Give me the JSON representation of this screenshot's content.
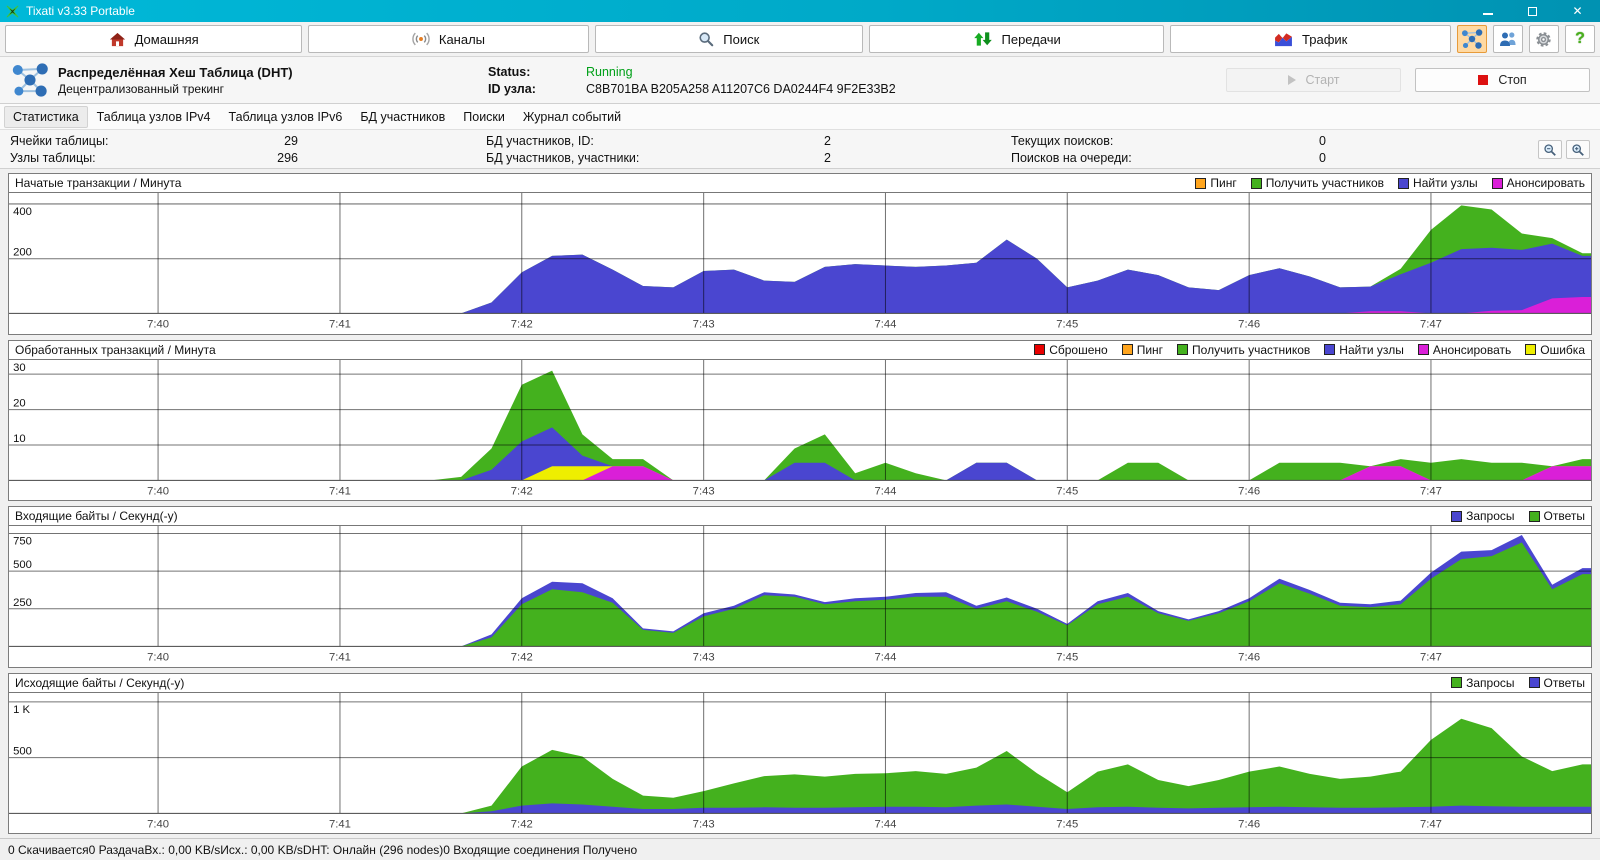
{
  "titlebar": {
    "title": "Tixati v3.33 Portable"
  },
  "toolbar": {
    "buttons": [
      {
        "label": "Домашняя",
        "icon": "home-icon"
      },
      {
        "label": "Каналы",
        "icon": "channels-icon"
      },
      {
        "label": "Поиск",
        "icon": "search-icon"
      },
      {
        "label": "Передачи",
        "icon": "transfers-icon"
      },
      {
        "label": "Трафик",
        "icon": "traffic-icon"
      }
    ],
    "right_buttons": [
      {
        "name": "dht",
        "icon": "dht-molecule-icon",
        "active": true
      },
      {
        "name": "peers",
        "icon": "people-icon",
        "active": false
      },
      {
        "name": "settings",
        "icon": "gear-icon",
        "active": false
      },
      {
        "name": "help",
        "icon": "question-icon",
        "active": false
      }
    ]
  },
  "dht": {
    "title": "Распределённая Хеш Таблица (DHT)",
    "subtitle": "Децентрализованный трекинг",
    "status_label": "Status:",
    "status_value": "Running",
    "status_color": "#00a018",
    "id_label": "ID узла:",
    "id_value": "C8B701BA B205A258 A11207C6 DA0244F4 9F2E33B2",
    "start_label": "Старт",
    "stop_label": "Стоп"
  },
  "tabs": [
    {
      "label": "Статистика",
      "active": true
    },
    {
      "label": "Таблица узлов IPv4",
      "active": false
    },
    {
      "label": "Таблица узлов IPv6",
      "active": false
    },
    {
      "label": "БД участников",
      "active": false
    },
    {
      "label": "Поиски",
      "active": false
    },
    {
      "label": "Журнал событий",
      "active": false
    }
  ],
  "stats": {
    "columns": [
      [
        {
          "label": "Ячейки таблицы:",
          "value": "29"
        },
        {
          "label": "Узлы таблицы:",
          "value": "296"
        }
      ],
      [
        {
          "label": "БД участников, ID:",
          "value": "2"
        },
        {
          "label": "БД участников, участники:",
          "value": "2"
        }
      ],
      [
        {
          "label": "Текущих поисков:",
          "value": "0"
        },
        {
          "label": "Поисков на очереди:",
          "value": "0"
        }
      ]
    ]
  },
  "status_bar": {
    "items": [
      "0 Скачивается",
      "0 Раздача",
      "Вх.: 0,00 KB/s",
      "Исх.: 0,00 KB/s",
      "DHT: Онлайн (296 nodes)",
      "0 Входящие соединения Получено"
    ]
  },
  "chart_data": [
    {
      "type": "area",
      "title": "Начатые транзакции / Минута",
      "x_axis": {
        "labels": [
          "7:40",
          "7:41",
          "7:42",
          "7:43",
          "7:44",
          "7:45",
          "7:46",
          "7:47"
        ],
        "offset_min": 0.82,
        "total_min": 8.7,
        "points_per_minute": 6
      },
      "y_ticks": [
        {
          "value": 200,
          "label": "200"
        },
        {
          "value": 400,
          "label": "400"
        }
      ],
      "y_max": 440,
      "legend": [
        {
          "label": "Пинг",
          "color": "#ffa51e"
        },
        {
          "label": "Получить участников",
          "color": "#44b11e"
        },
        {
          "label": "Найти узлы",
          "color": "#4a46d0"
        },
        {
          "label": "Анонсировать",
          "color": "#da1fd8"
        }
      ],
      "series": [
        {
          "name": "Анонсировать",
          "color": "#da1fd8",
          "values": [
            0,
            0,
            0,
            0,
            0,
            0,
            0,
            0,
            0,
            0,
            0,
            0,
            0,
            0,
            0,
            0,
            0,
            0,
            0,
            0,
            0,
            0,
            0,
            0,
            0,
            0,
            0,
            0,
            0,
            0,
            0,
            0,
            0,
            0,
            0,
            0,
            0,
            0,
            0,
            0,
            8,
            8,
            0,
            0,
            10,
            12,
            55,
            60
          ]
        },
        {
          "name": "Найти узлы",
          "color": "#4a46d0",
          "values": [
            0,
            0,
            0,
            0,
            0,
            0,
            0,
            0,
            0,
            0,
            0,
            40,
            150,
            210,
            215,
            160,
            100,
            95,
            155,
            160,
            120,
            115,
            170,
            180,
            175,
            170,
            175,
            185,
            270,
            200,
            95,
            120,
            160,
            140,
            95,
            85,
            140,
            165,
            135,
            95,
            90,
            135,
            185,
            235,
            230,
            220,
            200,
            150
          ]
        },
        {
          "name": "Получить участников",
          "color": "#44b11e",
          "values": [
            0,
            0,
            0,
            0,
            0,
            0,
            0,
            0,
            0,
            0,
            0,
            0,
            0,
            0,
            0,
            0,
            0,
            0,
            0,
            0,
            0,
            0,
            0,
            0,
            0,
            0,
            0,
            0,
            0,
            0,
            0,
            0,
            0,
            0,
            0,
            0,
            0,
            0,
            0,
            0,
            0,
            20,
            120,
            160,
            140,
            60,
            20,
            10
          ]
        }
      ]
    },
    {
      "type": "area",
      "title": "Обработанных транзакций / Минута",
      "x_axis": {
        "labels": [
          "7:40",
          "7:41",
          "7:42",
          "7:43",
          "7:44",
          "7:45",
          "7:46",
          "7:47"
        ],
        "offset_min": 0.82,
        "total_min": 8.7,
        "points_per_minute": 6
      },
      "y_ticks": [
        {
          "value": 10,
          "label": "10"
        },
        {
          "value": 20,
          "label": "20"
        },
        {
          "value": 30,
          "label": "30"
        }
      ],
      "y_max": 34,
      "legend": [
        {
          "label": "Сброшено",
          "color": "#e80000"
        },
        {
          "label": "Пинг",
          "color": "#ffa51e"
        },
        {
          "label": "Получить участников",
          "color": "#44b11e"
        },
        {
          "label": "Найти узлы",
          "color": "#4a46d0"
        },
        {
          "label": "Анонсировать",
          "color": "#da1fd8"
        },
        {
          "label": "Ошибка",
          "color": "#eeee00"
        }
      ],
      "series": [
        {
          "name": "Анонсировать",
          "color": "#da1fd8",
          "values": [
            0,
            0,
            0,
            0,
            0,
            0,
            0,
            0,
            0,
            0,
            0,
            0,
            0,
            0,
            0,
            4,
            4,
            0,
            0,
            0,
            0,
            0,
            0,
            0,
            0,
            0,
            0,
            0,
            0,
            0,
            0,
            0,
            0,
            0,
            0,
            0,
            0,
            0,
            0,
            0,
            4,
            4,
            0,
            0,
            0,
            0,
            4,
            4
          ]
        },
        {
          "name": "Ошибка",
          "color": "#eeee00",
          "values": [
            0,
            0,
            0,
            0,
            0,
            0,
            0,
            0,
            0,
            0,
            0,
            0,
            0,
            4,
            4,
            0,
            0,
            0,
            0,
            0,
            0,
            0,
            0,
            0,
            0,
            0,
            0,
            0,
            0,
            0,
            0,
            0,
            0,
            0,
            0,
            0,
            0,
            0,
            0,
            0,
            0,
            0,
            0,
            0,
            0,
            0,
            0,
            0
          ]
        },
        {
          "name": "Найти узлы",
          "color": "#4a46d0",
          "values": [
            0,
            0,
            0,
            0,
            0,
            0,
            0,
            0,
            0,
            0,
            0,
            3,
            11,
            11,
            3,
            0,
            0,
            0,
            0,
            0,
            0,
            5,
            5,
            0,
            0,
            0,
            0,
            5,
            5,
            0,
            0,
            0,
            0,
            0,
            0,
            0,
            0,
            0,
            0,
            0,
            0,
            0,
            0,
            0,
            0,
            0,
            0,
            0
          ]
        },
        {
          "name": "Получить участников",
          "color": "#44b11e",
          "values": [
            0,
            0,
            0,
            0,
            0,
            0,
            0,
            0,
            0,
            0,
            1,
            6,
            16,
            16,
            6,
            2,
            2,
            0,
            0,
            0,
            0,
            4,
            8,
            2,
            5,
            2,
            0,
            0,
            0,
            0,
            0,
            0,
            5,
            5,
            0,
            0,
            0,
            5,
            5,
            5,
            0,
            2,
            5,
            6,
            5,
            5,
            0,
            2
          ]
        }
      ]
    },
    {
      "type": "area",
      "title": "Входящие байты / Секунд(-у)",
      "x_axis": {
        "labels": [
          "7:40",
          "7:41",
          "7:42",
          "7:43",
          "7:44",
          "7:45",
          "7:46",
          "7:47"
        ],
        "offset_min": 0.82,
        "total_min": 8.7,
        "points_per_minute": 6
      },
      "y_ticks": [
        {
          "value": 250,
          "label": "250"
        },
        {
          "value": 500,
          "label": "500"
        },
        {
          "value": 750,
          "label": "750"
        }
      ],
      "y_max": 800,
      "legend": [
        {
          "label": "Запросы",
          "color": "#4a46d0"
        },
        {
          "label": "Ответы",
          "color": "#44b11e"
        }
      ],
      "series": [
        {
          "name": "Ответы",
          "color": "#44b11e",
          "values": [
            0,
            0,
            0,
            0,
            0,
            0,
            0,
            0,
            0,
            0,
            0,
            60,
            280,
            380,
            360,
            290,
            110,
            90,
            200,
            250,
            340,
            330,
            280,
            300,
            310,
            330,
            330,
            250,
            300,
            230,
            140,
            280,
            330,
            220,
            170,
            220,
            300,
            420,
            350,
            270,
            260,
            280,
            450,
            580,
            600,
            690,
            380,
            480
          ]
        },
        {
          "name": "Запросы",
          "color": "#4a46d0",
          "values": [
            0,
            0,
            0,
            0,
            0,
            0,
            0,
            0,
            0,
            0,
            0,
            20,
            40,
            50,
            60,
            30,
            10,
            10,
            20,
            20,
            20,
            15,
            15,
            20,
            20,
            25,
            30,
            20,
            25,
            20,
            10,
            20,
            25,
            15,
            10,
            15,
            20,
            30,
            25,
            20,
            20,
            25,
            40,
            50,
            40,
            50,
            30,
            40
          ]
        }
      ]
    },
    {
      "type": "area",
      "title": "Исходящие байты / Секунд(-у)",
      "x_axis": {
        "labels": [
          "7:40",
          "7:41",
          "7:42",
          "7:43",
          "7:44",
          "7:45",
          "7:46",
          "7:47"
        ],
        "offset_min": 0.82,
        "total_min": 8.7,
        "points_per_minute": 6
      },
      "y_ticks": [
        {
          "value": 500,
          "label": "500"
        },
        {
          "value": 1000,
          "label": "1 K"
        }
      ],
      "y_max": 1080,
      "legend": [
        {
          "label": "Запросы",
          "color": "#44b11e"
        },
        {
          "label": "Ответы",
          "color": "#4a46d0"
        }
      ],
      "series": [
        {
          "name": "Ответы",
          "color": "#4a46d0",
          "values": [
            0,
            0,
            0,
            0,
            0,
            0,
            0,
            0,
            0,
            0,
            0,
            20,
            70,
            90,
            80,
            60,
            40,
            40,
            50,
            50,
            55,
            50,
            50,
            55,
            60,
            60,
            55,
            70,
            80,
            60,
            40,
            55,
            60,
            50,
            45,
            50,
            55,
            60,
            55,
            50,
            50,
            55,
            60,
            70,
            65,
            60,
            60,
            60
          ]
        },
        {
          "name": "Запросы",
          "color": "#44b11e",
          "values": [
            0,
            0,
            0,
            0,
            0,
            0,
            0,
            0,
            0,
            0,
            0,
            50,
            350,
            480,
            430,
            250,
            120,
            100,
            150,
            220,
            280,
            300,
            280,
            300,
            300,
            320,
            300,
            340,
            480,
            300,
            150,
            320,
            380,
            250,
            200,
            250,
            320,
            360,
            300,
            260,
            280,
            320,
            600,
            780,
            700,
            450,
            320,
            380
          ]
        }
      ]
    }
  ]
}
